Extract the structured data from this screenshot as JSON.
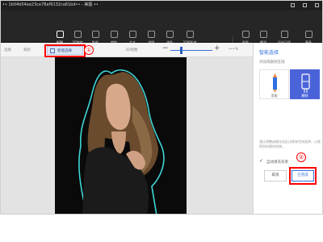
{
  "window": {
    "title": "•• 1b04b54ee23ce78af9132ca61bd•• - 美图 ••"
  },
  "ribbon": {
    "items": [
      {
        "label": "抠图",
        "icon": "brush-icon"
      },
      {
        "label": "3D旋转",
        "icon": "cube-icon"
      },
      {
        "label": "贴纸",
        "icon": "sticker-icon"
      },
      {
        "label": "裁剪",
        "icon": "crop-icon"
      },
      {
        "label": "文本",
        "icon": "text-icon"
      },
      {
        "label": "滤镜",
        "icon": "filter-icon"
      },
      {
        "label": "调色",
        "icon": "adjust-icon"
      },
      {
        "label": "3D图形库",
        "icon": "library-icon"
      },
      {
        "label": "粘贴",
        "icon": "paste-icon"
      },
      {
        "label": "撤消",
        "icon": "undo-icon"
      },
      {
        "label": "历史记录",
        "icon": "history-icon"
      },
      {
        "label": "更多",
        "icon": "more-icon"
      }
    ]
  },
  "toolbar": {
    "left_text": "选择",
    "crop_text": "裁剪",
    "smart_select_label": "智能选择",
    "view_label": "3D视图",
    "zoom_value": "•••%"
  },
  "panel": {
    "title": "智能选择",
    "subtitle": "添加或删除区域",
    "brush_add_label": "添加",
    "brush_remove_label": "删除",
    "description": "通过调整或细化选区边缘来完成选择，以便得到所需的效果。",
    "auto_fill_label": "自动填充背景",
    "cancel_label": "取消",
    "apply_label": "已完成"
  },
  "annotations": {
    "callout_1": "①",
    "callout_2": "②"
  },
  "colors": {
    "accent": "#2f6fe0",
    "annotation": "#ff0000",
    "selection_outline": "#3fd6d6",
    "ribbon_bg": "#262626"
  }
}
